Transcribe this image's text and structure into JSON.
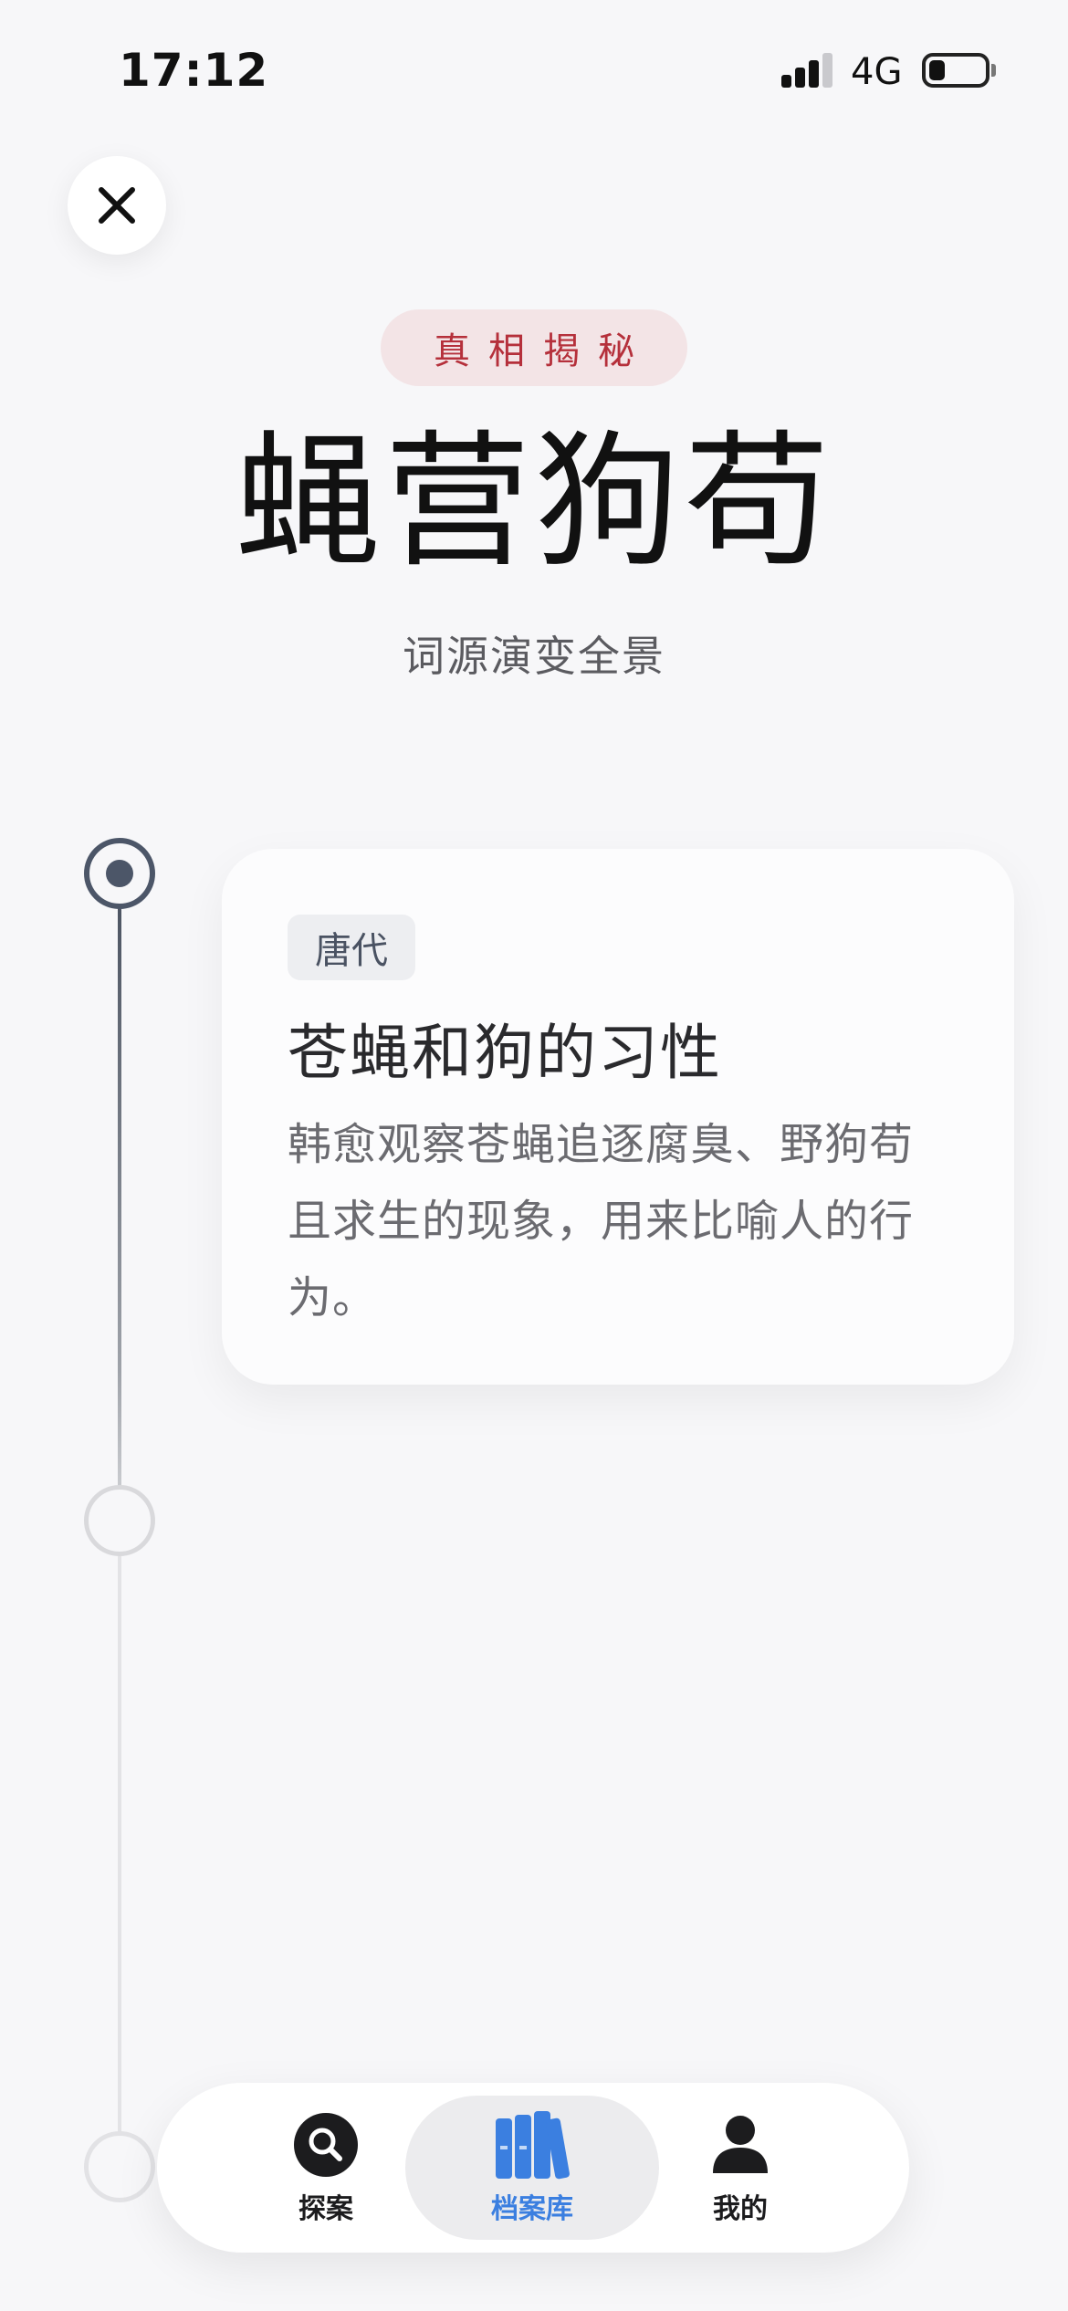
{
  "status_bar": {
    "time": "17:12",
    "network": "4G",
    "signal_bars": 3,
    "battery_level": 0.3
  },
  "header": {
    "badge": "真相揭秘",
    "title": "蝇营狗苟",
    "subtitle": "词源演变全景"
  },
  "timeline": {
    "active_index": 0,
    "events": [
      {
        "era": "唐代",
        "title": "苍蝇和狗的习性",
        "description": "韩愈观察苍蝇追逐腐臭、野狗苟且求生的现象，用来比喻人的行为。"
      }
    ]
  },
  "tab_bar": {
    "selected": 1,
    "tabs": [
      {
        "label": "探案",
        "icon": "search-icon"
      },
      {
        "label": "档案库",
        "icon": "library-books-icon"
      },
      {
        "label": "我的",
        "icon": "person-icon"
      }
    ]
  },
  "colors": {
    "badge_text": "#b5303b",
    "badge_bg": "#f3e4e6",
    "accent_blue": "#3b7fe0",
    "timeline_active": "#4c5668"
  }
}
